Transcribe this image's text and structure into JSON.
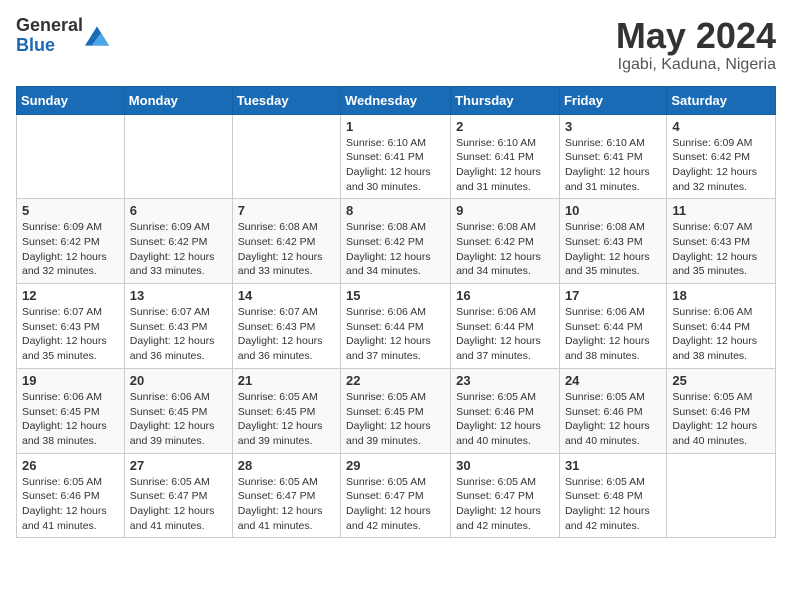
{
  "logo": {
    "text_general": "General",
    "text_blue": "Blue"
  },
  "title": {
    "month_year": "May 2024",
    "location": "Igabi, Kaduna, Nigeria"
  },
  "weekdays": [
    "Sunday",
    "Monday",
    "Tuesday",
    "Wednesday",
    "Thursday",
    "Friday",
    "Saturday"
  ],
  "weeks": [
    [
      {
        "day": "",
        "info": ""
      },
      {
        "day": "",
        "info": ""
      },
      {
        "day": "",
        "info": ""
      },
      {
        "day": "1",
        "info": "Sunrise: 6:10 AM\nSunset: 6:41 PM\nDaylight: 12 hours\nand 30 minutes."
      },
      {
        "day": "2",
        "info": "Sunrise: 6:10 AM\nSunset: 6:41 PM\nDaylight: 12 hours\nand 31 minutes."
      },
      {
        "day": "3",
        "info": "Sunrise: 6:10 AM\nSunset: 6:41 PM\nDaylight: 12 hours\nand 31 minutes."
      },
      {
        "day": "4",
        "info": "Sunrise: 6:09 AM\nSunset: 6:42 PM\nDaylight: 12 hours\nand 32 minutes."
      }
    ],
    [
      {
        "day": "5",
        "info": "Sunrise: 6:09 AM\nSunset: 6:42 PM\nDaylight: 12 hours\nand 32 minutes."
      },
      {
        "day": "6",
        "info": "Sunrise: 6:09 AM\nSunset: 6:42 PM\nDaylight: 12 hours\nand 33 minutes."
      },
      {
        "day": "7",
        "info": "Sunrise: 6:08 AM\nSunset: 6:42 PM\nDaylight: 12 hours\nand 33 minutes."
      },
      {
        "day": "8",
        "info": "Sunrise: 6:08 AM\nSunset: 6:42 PM\nDaylight: 12 hours\nand 34 minutes."
      },
      {
        "day": "9",
        "info": "Sunrise: 6:08 AM\nSunset: 6:42 PM\nDaylight: 12 hours\nand 34 minutes."
      },
      {
        "day": "10",
        "info": "Sunrise: 6:08 AM\nSunset: 6:43 PM\nDaylight: 12 hours\nand 35 minutes."
      },
      {
        "day": "11",
        "info": "Sunrise: 6:07 AM\nSunset: 6:43 PM\nDaylight: 12 hours\nand 35 minutes."
      }
    ],
    [
      {
        "day": "12",
        "info": "Sunrise: 6:07 AM\nSunset: 6:43 PM\nDaylight: 12 hours\nand 35 minutes."
      },
      {
        "day": "13",
        "info": "Sunrise: 6:07 AM\nSunset: 6:43 PM\nDaylight: 12 hours\nand 36 minutes."
      },
      {
        "day": "14",
        "info": "Sunrise: 6:07 AM\nSunset: 6:43 PM\nDaylight: 12 hours\nand 36 minutes."
      },
      {
        "day": "15",
        "info": "Sunrise: 6:06 AM\nSunset: 6:44 PM\nDaylight: 12 hours\nand 37 minutes."
      },
      {
        "day": "16",
        "info": "Sunrise: 6:06 AM\nSunset: 6:44 PM\nDaylight: 12 hours\nand 37 minutes."
      },
      {
        "day": "17",
        "info": "Sunrise: 6:06 AM\nSunset: 6:44 PM\nDaylight: 12 hours\nand 38 minutes."
      },
      {
        "day": "18",
        "info": "Sunrise: 6:06 AM\nSunset: 6:44 PM\nDaylight: 12 hours\nand 38 minutes."
      }
    ],
    [
      {
        "day": "19",
        "info": "Sunrise: 6:06 AM\nSunset: 6:45 PM\nDaylight: 12 hours\nand 38 minutes."
      },
      {
        "day": "20",
        "info": "Sunrise: 6:06 AM\nSunset: 6:45 PM\nDaylight: 12 hours\nand 39 minutes."
      },
      {
        "day": "21",
        "info": "Sunrise: 6:05 AM\nSunset: 6:45 PM\nDaylight: 12 hours\nand 39 minutes."
      },
      {
        "day": "22",
        "info": "Sunrise: 6:05 AM\nSunset: 6:45 PM\nDaylight: 12 hours\nand 39 minutes."
      },
      {
        "day": "23",
        "info": "Sunrise: 6:05 AM\nSunset: 6:46 PM\nDaylight: 12 hours\nand 40 minutes."
      },
      {
        "day": "24",
        "info": "Sunrise: 6:05 AM\nSunset: 6:46 PM\nDaylight: 12 hours\nand 40 minutes."
      },
      {
        "day": "25",
        "info": "Sunrise: 6:05 AM\nSunset: 6:46 PM\nDaylight: 12 hours\nand 40 minutes."
      }
    ],
    [
      {
        "day": "26",
        "info": "Sunrise: 6:05 AM\nSunset: 6:46 PM\nDaylight: 12 hours\nand 41 minutes."
      },
      {
        "day": "27",
        "info": "Sunrise: 6:05 AM\nSunset: 6:47 PM\nDaylight: 12 hours\nand 41 minutes."
      },
      {
        "day": "28",
        "info": "Sunrise: 6:05 AM\nSunset: 6:47 PM\nDaylight: 12 hours\nand 41 minutes."
      },
      {
        "day": "29",
        "info": "Sunrise: 6:05 AM\nSunset: 6:47 PM\nDaylight: 12 hours\nand 42 minutes."
      },
      {
        "day": "30",
        "info": "Sunrise: 6:05 AM\nSunset: 6:47 PM\nDaylight: 12 hours\nand 42 minutes."
      },
      {
        "day": "31",
        "info": "Sunrise: 6:05 AM\nSunset: 6:48 PM\nDaylight: 12 hours\nand 42 minutes."
      },
      {
        "day": "",
        "info": ""
      }
    ]
  ]
}
